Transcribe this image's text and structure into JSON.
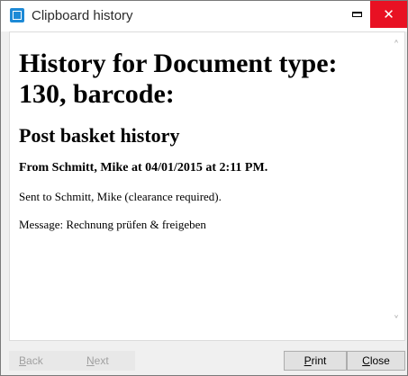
{
  "window": {
    "title": "Clipboard history",
    "close_glyph": "✕",
    "icons": [
      "app-icon",
      "minimize-icon",
      "close-icon"
    ]
  },
  "document": {
    "heading": "History for Document type: 130, barcode:",
    "subheading": "Post basket history",
    "from_line": "From Schmitt, Mike at 04/01/2015 at 2:11 PM.",
    "sent_line": "Sent to Schmitt, Mike (clearance required).",
    "message_line": "Message: Rechnung prüfen & freigeben"
  },
  "scrollbar": {
    "up_glyph": "˄",
    "down_glyph": "˅"
  },
  "buttons": {
    "back": {
      "mnemonic": "B",
      "rest": "ack",
      "enabled": false
    },
    "next": {
      "mnemonic": "N",
      "rest": "ext",
      "enabled": false
    },
    "print": {
      "mnemonic": "P",
      "rest": "rint",
      "enabled": true
    },
    "close": {
      "mnemonic": "C",
      "rest": "lose",
      "enabled": true
    }
  },
  "colors": {
    "close_button_bg": "#e81123",
    "app_icon": "#1e8ad6",
    "disabled_text": "#a0a0a0"
  }
}
